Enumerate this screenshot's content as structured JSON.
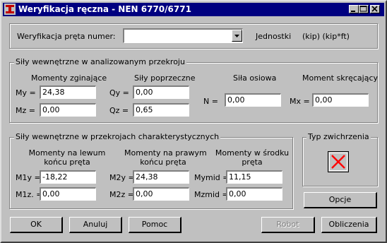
{
  "window": {
    "title": "Weryfikacja ręczna - NEN 6770/6771"
  },
  "top": {
    "label": "Weryfikacja pręta numer:",
    "select_value": "",
    "units_label": "Jednostki",
    "units_value": "(kip) (kip*ft)"
  },
  "internal": {
    "title": "Siły wewnętrzne w analizowanym przekroju",
    "bending_header": "Momenty zginające",
    "shear_header": "Siły poprzeczne",
    "axial_header": "Siła osiowa",
    "torsion_header": "Moment skręcający",
    "my_label": "My =",
    "my_value": "24,38",
    "mz_label": "Mz =",
    "mz_value": "0,00",
    "qy_label": "Qy =",
    "qy_value": "0,00",
    "qz_label": "Qz =",
    "qz_value": "0,65",
    "n_label": "N =",
    "n_value": "0,00",
    "mx_label": "Mx =",
    "mx_value": "0,00"
  },
  "characteristic": {
    "title": "Siły wewnętrzne w przekrojach charakterystycznych",
    "left_header_1": "Momenty na lewum",
    "left_header_2": "końcu pręta",
    "right_header_1": "Momenty na prawym",
    "right_header_2": "końcu pręta",
    "mid_header_1": "Momenty w środku",
    "mid_header_2": "pręta",
    "m1y_label": "M1y =",
    "m1y_value": "-18,22",
    "m1z_label": "M1z. =",
    "m1z_value": "0,00",
    "m2y_label": "M2y =",
    "m2y_value": "24,38",
    "m2z_label": "M2z =",
    "m2z_value": "0,00",
    "mymid_label": "Mymid =",
    "mymid_value": "11,15",
    "mzmid_label": "Mzmid =",
    "mzmid_value": "0,00"
  },
  "buckling": {
    "title": "Typ zwichrzenia",
    "icon": "red-x-icon"
  },
  "buttons": {
    "opcje": "Opcje",
    "ok": "OK",
    "anuluj": "Anuluj",
    "pomoc": "Pomoc",
    "robot": "Robot",
    "obliczenia": "Obliczenia"
  },
  "colors": {
    "titlebar": "#000080",
    "face": "#c0c0c0",
    "red_x": "#ff0000"
  }
}
